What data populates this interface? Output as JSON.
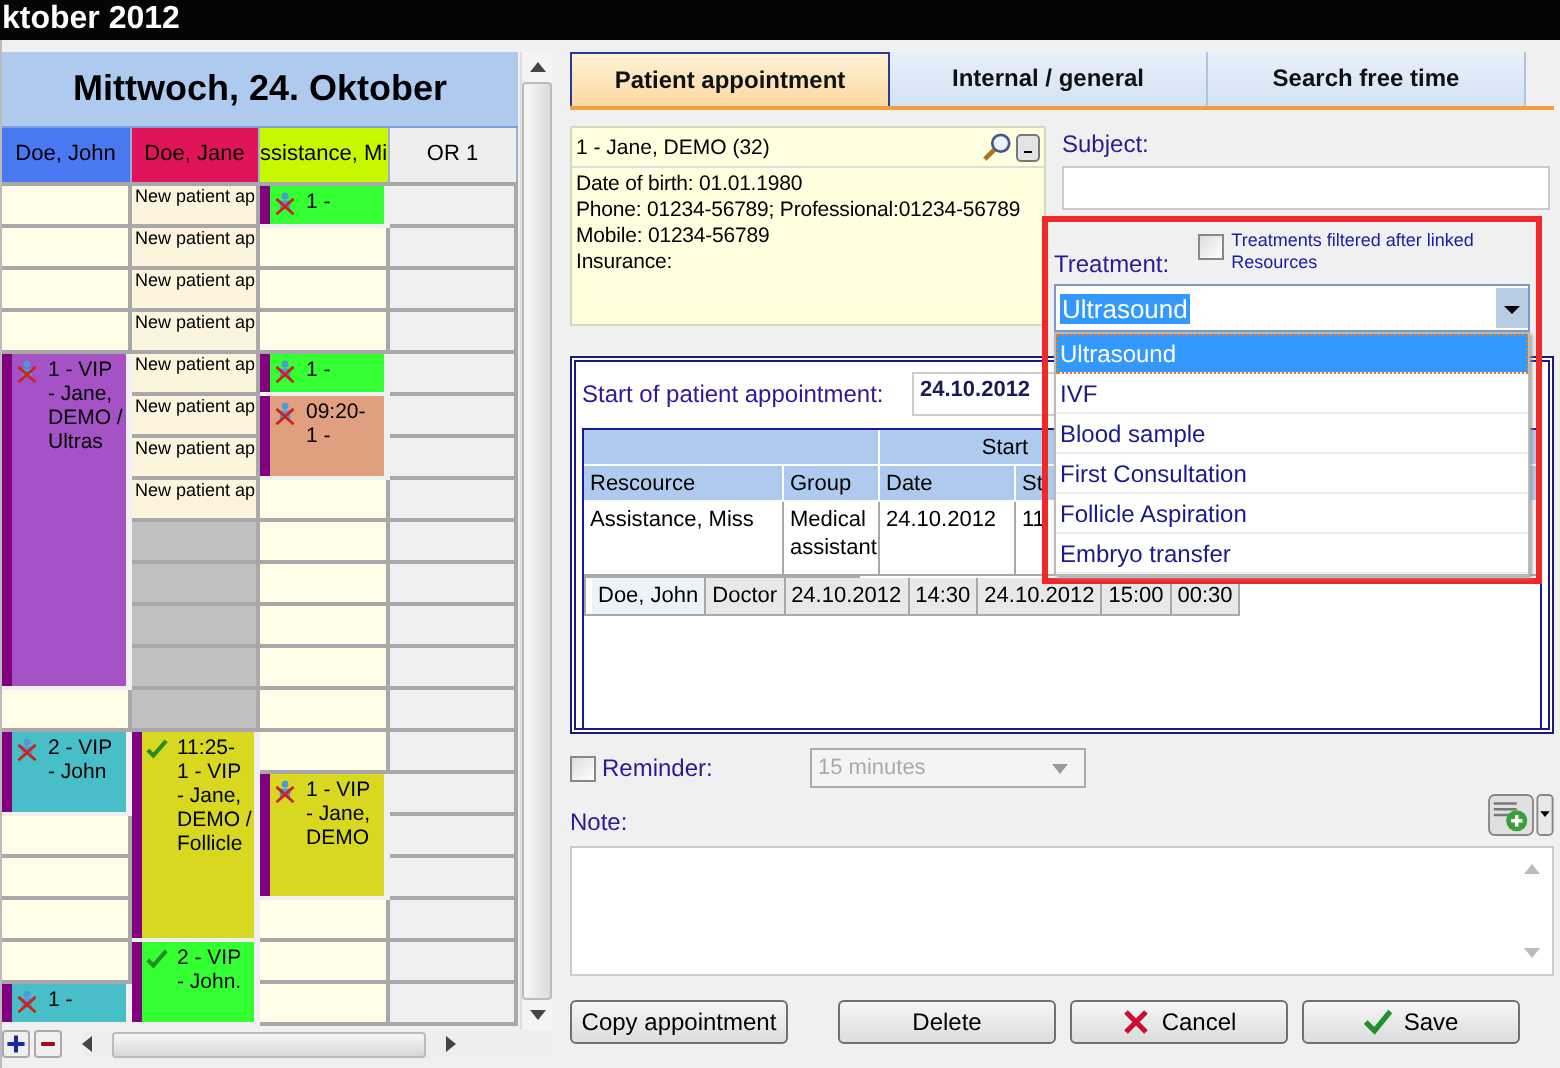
{
  "window": {
    "title": "ktober 2012"
  },
  "calendar": {
    "day_title": "Mittwoch, 24. Oktober",
    "resources": [
      {
        "name": "Doe, John",
        "color": "#4a78f0",
        "available": true,
        "appointments": [
          {
            "text": "1 - VIP - Jane, DEMO / Ultras",
            "color": "#a452c6",
            "kind": "cancelled"
          },
          {
            "text": "2 - VIP - John",
            "color": "#48bec8",
            "kind": "cancelled"
          },
          {
            "text": "1 -",
            "color": "#48bec8",
            "kind": "cancelled"
          }
        ]
      },
      {
        "name": "Doe, Jane",
        "color": "#e0145a",
        "available": true,
        "slots": [
          {
            "kind": "text",
            "label": "New patient ap"
          },
          {
            "kind": "text",
            "label": "New patient ap"
          },
          {
            "kind": "text",
            "label": "New patient ap"
          },
          {
            "kind": "text",
            "label": "New patient ap"
          },
          {
            "kind": "text",
            "label": "New patient ap"
          },
          {
            "kind": "text",
            "label": "New patient ap"
          },
          {
            "kind": "text",
            "label": "New patient ap"
          },
          {
            "kind": "text",
            "label": "New patient ap"
          },
          {
            "kind": "blocked"
          },
          {
            "kind": "blocked"
          },
          {
            "kind": "blocked"
          },
          {
            "kind": "blocked"
          },
          {
            "kind": "blocked"
          }
        ],
        "appointments": [
          {
            "text": "11:25- 1 - VIP - Jane, DEMO / Follicle",
            "color": "#d8d820",
            "kind": "confirmed"
          },
          {
            "text": "2 - VIP - John.",
            "color": "#33ff33",
            "kind": "confirmed"
          }
        ]
      },
      {
        "name": "ssistance, Mi",
        "color": "#c8f800",
        "available": true,
        "appointments": [
          {
            "text": "1 -",
            "color": "#33ff33",
            "kind": "cancelled"
          },
          {
            "text": "1 -",
            "color": "#33ff33",
            "kind": "cancelled"
          },
          {
            "text": "09:20- 1 -",
            "color": "#e0a080",
            "kind": "cancelled"
          },
          {
            "text": "1 - VIP - Jane, DEMO",
            "color": "#d8d820",
            "kind": "cancelled"
          }
        ]
      },
      {
        "name": "OR 1",
        "color": "#eeeeee",
        "available": false
      }
    ]
  },
  "tabs": [
    {
      "label": "Patient appointment",
      "selected": true
    },
    {
      "label": "Internal / general",
      "selected": false
    },
    {
      "label": "Search free time",
      "selected": false
    }
  ],
  "patient": {
    "name_line": "1 - Jane, DEMO (32)",
    "details": [
      "Date of birth: 01.01.1980",
      "Phone: 01234-56789; Professional:01234-56789",
      "Mobile: 01234-56789",
      "Insurance:"
    ]
  },
  "subject": {
    "label": "Subject:"
  },
  "treatment": {
    "label": "Treatment:",
    "filter_checkbox": {
      "label": "Treatments filtered after linked Resources",
      "checked": false
    },
    "value": "Ultrasound",
    "expanded": true,
    "options": [
      {
        "label": "Ultrasound",
        "selected": true
      },
      {
        "label": "IVF",
        "selected": false
      },
      {
        "label": "Blood sample",
        "selected": false
      },
      {
        "label": "First Consultation",
        "selected": false
      },
      {
        "label": "Follicle Aspiration",
        "selected": false
      },
      {
        "label": "Embryo transfer",
        "selected": false
      }
    ]
  },
  "schedule": {
    "start_label": "Start of patient appointment:",
    "start_date": "24.10.2012",
    "table": {
      "group_header": "Start",
      "columns": [
        "Rescource",
        "Group",
        "Date",
        "St"
      ],
      "rows": [
        {
          "cells": [
            "Assistance, Miss",
            "Medical assistant",
            "24.10.2012",
            "11"
          ],
          "selected": false
        },
        {
          "cells": [
            "Doe, John",
            "Doctor",
            "24.10.2012",
            "14:30",
            "24.10.2012",
            "15:00",
            "00:30"
          ],
          "selected": true
        }
      ]
    }
  },
  "reminder": {
    "label": "Reminder:",
    "checked": false,
    "value": "15 minutes",
    "disabled": true
  },
  "note": {
    "label": "Note:"
  },
  "buttons": [
    {
      "label": "Copy appointment",
      "kind": "plain"
    },
    {
      "label": "Delete",
      "kind": "plain"
    },
    {
      "label": "Cancel",
      "kind": "cancel"
    },
    {
      "label": "Save",
      "kind": "save"
    }
  ]
}
